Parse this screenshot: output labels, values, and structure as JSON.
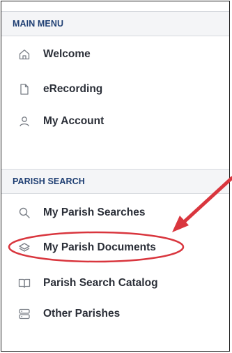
{
  "main_menu": {
    "header": "MAIN MENU",
    "items": [
      {
        "label": "Welcome",
        "icon": "home-icon"
      },
      {
        "label": "eRecording",
        "icon": "document-icon"
      },
      {
        "label": "My Account",
        "icon": "user-icon"
      }
    ]
  },
  "parish_search": {
    "header": "PARISH SEARCH",
    "items": [
      {
        "label": "My Parish Searches",
        "icon": "search-icon"
      },
      {
        "label": "My Parish Documents",
        "icon": "layers-icon"
      },
      {
        "label": "Parish Search Catalog",
        "icon": "book-icon"
      },
      {
        "label": "Other Parishes",
        "icon": "server-icon"
      }
    ]
  },
  "annotation": {
    "highlight_color": "#d9363e",
    "highlighted_item": "My Parish Documents"
  },
  "colors": {
    "header_text": "#1f3f73",
    "header_bg": "#f4f5f7",
    "item_text": "#2b2f38",
    "icon_stroke": "#7a7f87"
  }
}
